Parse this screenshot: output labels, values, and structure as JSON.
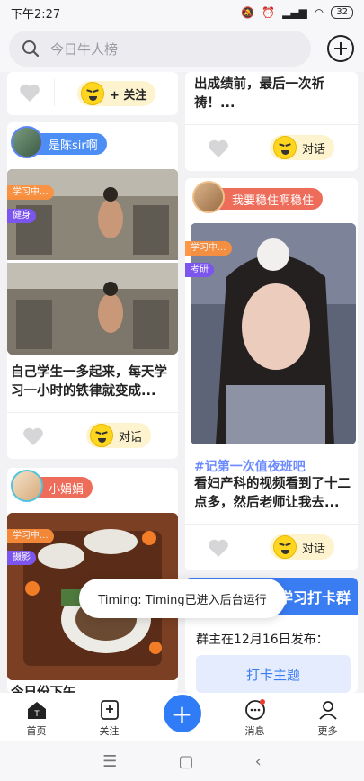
{
  "status": {
    "time": "下午2:27",
    "battery": "32"
  },
  "search": {
    "placeholder": "今日牛人榜"
  },
  "left_col": {
    "card0": {
      "follow": "+ 关注"
    },
    "card1": {
      "user": "是陈sir啊",
      "study_tag": "学习中...",
      "category": "健身",
      "text": "自己学生一多起来，每天学习一小时的铁律就变成...",
      "chat": "对话"
    },
    "card2": {
      "user": "小娟娟",
      "study_tag": "学习中...",
      "category": "摄影",
      "text": "今日份下午..."
    }
  },
  "right_col": {
    "card0": {
      "text": "出成绩前，最后一次祈祷！...",
      "chat": "对话"
    },
    "card1": {
      "user": "我要稳住啊稳住",
      "study_tag": "学习中...",
      "category": "考研",
      "hashtag": "#记第一次值夜班吧",
      "text": "看妇产科的视频看到了十二点多，然后老师让我去...",
      "chat": "对话"
    },
    "card2": {
      "banner": "学习打卡群",
      "owner_line": "群主在12月16日发布：",
      "button": "打卡主题"
    }
  },
  "toast": "Timing: Timing已进入后台运行",
  "nav": [
    {
      "label": "首页",
      "icon": "home-icon"
    },
    {
      "label": "关注",
      "icon": "follow-icon"
    },
    {
      "label": "",
      "icon": "plus-icon"
    },
    {
      "label": "消息",
      "icon": "message-icon"
    },
    {
      "label": "更多",
      "icon": "user-icon"
    }
  ],
  "colors": {
    "accent": "#2f7cf6",
    "tag_blue": "#4d8ef5",
    "tag_red": "#ee6d5a",
    "study": "#ff8f3a",
    "category": "#7b55ee"
  }
}
